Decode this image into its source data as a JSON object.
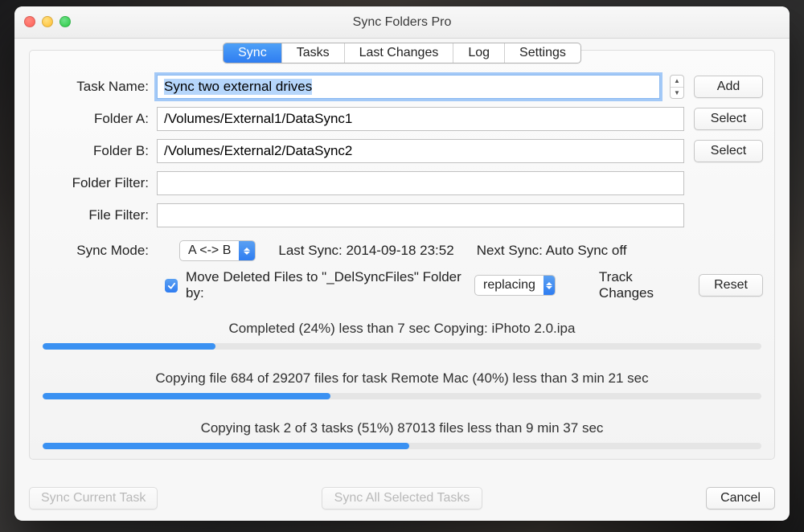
{
  "window": {
    "title": "Sync Folders Pro"
  },
  "tabs": [
    "Sync",
    "Tasks",
    "Last Changes",
    "Log",
    "Settings"
  ],
  "activeTab": 0,
  "labels": {
    "task_name": "Task Name:",
    "folder_a": "Folder A:",
    "folder_b": "Folder B:",
    "folder_filter": "Folder Filter:",
    "file_filter": "File Filter:",
    "sync_mode": "Sync Mode:"
  },
  "fields": {
    "task_name": "Sync two external drives",
    "folder_a": "/Volumes/External1/DataSync1",
    "folder_b": "/Volumes/External2/DataSync2",
    "folder_filter": "",
    "file_filter": ""
  },
  "buttons": {
    "add": "Add",
    "select": "Select",
    "reset": "Reset",
    "sync_current": "Sync Current Task",
    "sync_all": "Sync All Selected Tasks",
    "cancel": "Cancel"
  },
  "sync_mode": {
    "value": "A <-> B"
  },
  "last_sync": "Last Sync: 2014-09-18 23:52",
  "next_sync": "Next Sync: Auto Sync off",
  "move_deleted": {
    "checked": true,
    "label": "Move Deleted Files to \"_DelSyncFiles\" Folder by:",
    "mode": "replacing"
  },
  "track_changes": "Track Changes",
  "progress": [
    {
      "label": "Completed (24%) less than 7 sec Copying: iPhoto 2.0.ipa",
      "pct": 24
    },
    {
      "label": "Copying file 684 of 29207 files for task Remote Mac (40%) less than 3 min 21 sec",
      "pct": 40
    },
    {
      "label": "Copying task 2 of 3 tasks (51%) 87013 files less than 9 min 37 sec",
      "pct": 51
    }
  ]
}
